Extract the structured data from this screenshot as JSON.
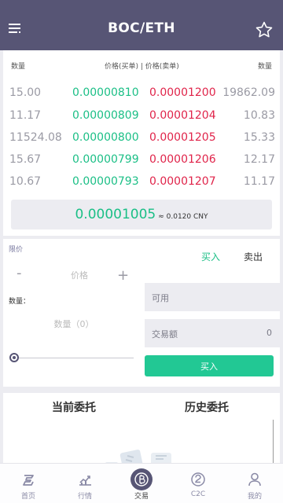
{
  "header": {
    "title": "BOC/ETH",
    "menu_icon": "menu-icon",
    "favorite_icon": "star-icon"
  },
  "orderbook": {
    "headers": {
      "qty_left": "数量",
      "price": "价格(买单) | 价格(卖单)",
      "qty_right": "数量"
    },
    "rows": [
      {
        "bid_qty": "15.00",
        "bid_price": "0.00000810",
        "ask_price": "0.00001200",
        "ask_qty": "19862.09"
      },
      {
        "bid_qty": "11.17",
        "bid_price": "0.00000809",
        "ask_price": "0.00001204",
        "ask_qty": "10.83"
      },
      {
        "bid_qty": "11524.08",
        "bid_price": "0.00000800",
        "ask_price": "0.00001205",
        "ask_qty": "15.33"
      },
      {
        "bid_qty": "15.67",
        "bid_price": "0.00000799",
        "ask_price": "0.00001206",
        "ask_qty": "12.17"
      },
      {
        "bid_qty": "10.67",
        "bid_price": "0.00000793",
        "ask_price": "0.00001207",
        "ask_qty": "11.17"
      }
    ],
    "last_price": "0.00001005",
    "cny_equiv": "≈ 0.0120 CNY"
  },
  "trade": {
    "order_type": "限价",
    "minus": "-",
    "plus": "+",
    "price_placeholder": "价格",
    "qty_label": "数量：",
    "qty_placeholder": "数量（0）",
    "slider_value_percent": 0,
    "tab_buy": "买入",
    "tab_sell": "卖出",
    "available_label": "可用",
    "available_value": "",
    "amount_label": "交易额",
    "amount_value": "0",
    "buy_button": "买入"
  },
  "orders": {
    "tab_current": "当前委托",
    "tab_history": "历史委托"
  },
  "tabbar": {
    "items": [
      {
        "label": "首页",
        "icon": "home-icon"
      },
      {
        "label": "行情",
        "icon": "chart-icon"
      },
      {
        "label": "交易",
        "icon": "bitcoin-icon"
      },
      {
        "label": "C2C",
        "icon": "c2c-icon"
      },
      {
        "label": "我的",
        "icon": "user-icon"
      }
    ],
    "active_index": 2
  },
  "colors": {
    "header": "#575575",
    "buy": "#1bbf86",
    "sell": "#e0244a",
    "button": "#22c894"
  }
}
